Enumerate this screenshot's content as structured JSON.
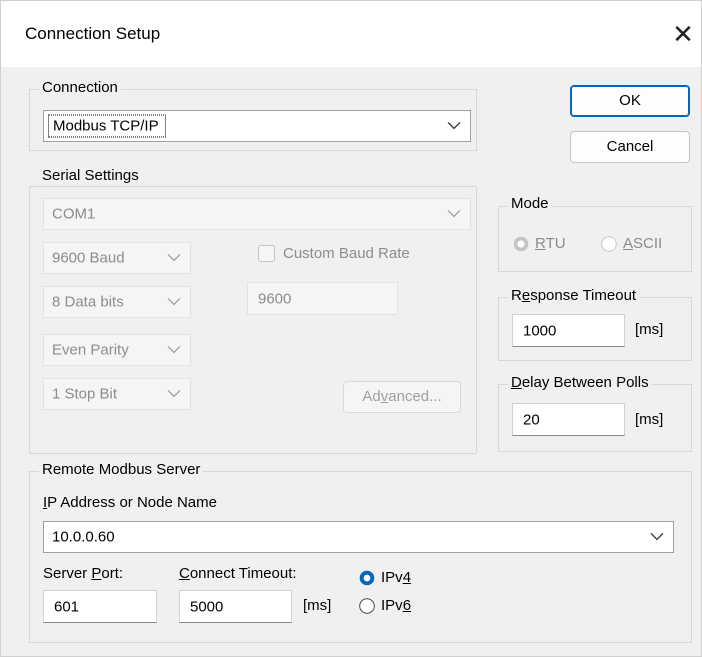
{
  "window": {
    "title": "Connection Setup",
    "close_glyph": "✕"
  },
  "buttons": {
    "ok": "OK",
    "cancel": "Cancel"
  },
  "connection": {
    "group_label": "Connection",
    "selected": "Modbus TCP/IP"
  },
  "serial": {
    "group_label": "Serial Settings",
    "port": "COM1",
    "baud": "9600 Baud",
    "data_bits": "8 Data bits",
    "parity": "Even Parity",
    "stop_bits": "1 Stop Bit",
    "custom_baud_label": "Custom Baud Rate",
    "custom_baud_checked": false,
    "custom_baud_value": "9600",
    "advanced_pre": "Ad",
    "advanced_mnemonic": "v",
    "advanced_post": "anced..."
  },
  "mode": {
    "group_label": "Mode",
    "rtu_mnemonic": "R",
    "rtu_rest": "TU",
    "ascii_mnemonic": "A",
    "ascii_rest": "SCII",
    "selected": "RTU"
  },
  "response_timeout": {
    "label_pre": "R",
    "label_mnemonic": "e",
    "label_post": "sponse Timeout",
    "value": "1000",
    "unit": "[ms]"
  },
  "delay_between_polls": {
    "label_mnemonic": "D",
    "label_post": "elay Between Polls",
    "value": "20",
    "unit": "[ms]"
  },
  "remote": {
    "group_label": "Remote Modbus Server",
    "ip_label_mnemonic": "I",
    "ip_label_post": "P Address or Node Name",
    "ip_value": "10.0.0.60",
    "port_label_pre": "Server ",
    "port_label_mnemonic": "P",
    "port_label_post": "ort:",
    "port_value": "601",
    "timeout_label_mnemonic": "C",
    "timeout_label_post": "onnect Timeout:",
    "timeout_value": "5000",
    "timeout_unit": "[ms]",
    "ipv4_pre": "IPv",
    "ipv4_mnemonic": "4",
    "ipv6_pre": "IPv",
    "ipv6_mnemonic": "6",
    "selected_ip_version": "IPv4"
  },
  "colors": {
    "accent": "#0067c0",
    "disabled_text": "#8c8c8c"
  }
}
